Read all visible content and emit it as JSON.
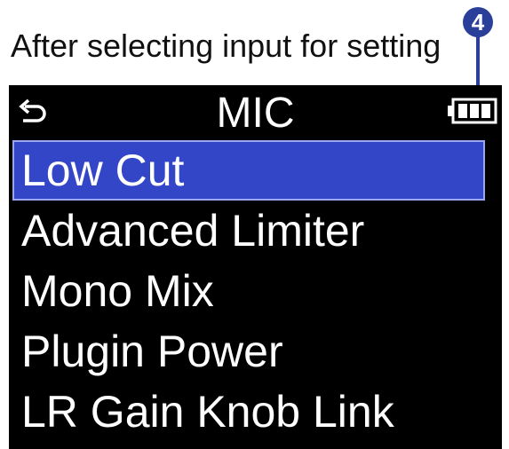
{
  "caption": "After selecting input for setting",
  "callout": {
    "number": "4",
    "color": "#2a3f9a"
  },
  "screen": {
    "background": "#000000",
    "selection_color": "#3346c8",
    "header": {
      "back_icon": "return-arrow-icon",
      "title": "MIC",
      "battery_icon": "battery-icon",
      "battery_level": "full"
    },
    "menu": [
      {
        "label": "Low Cut",
        "selected": true
      },
      {
        "label": "Advanced Limiter",
        "selected": false
      },
      {
        "label": "Mono Mix",
        "selected": false
      },
      {
        "label": "Plugin Power",
        "selected": false
      },
      {
        "label": "LR Gain Knob Link",
        "selected": false
      }
    ]
  }
}
